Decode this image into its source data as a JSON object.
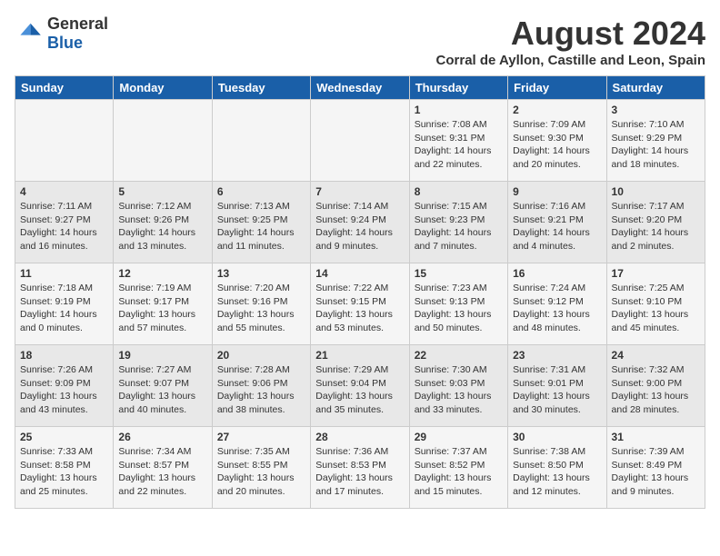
{
  "logo": {
    "general": "General",
    "blue": "Blue"
  },
  "title": {
    "month_year": "August 2024",
    "location": "Corral de Ayllon, Castille and Leon, Spain"
  },
  "days_of_week": [
    "Sunday",
    "Monday",
    "Tuesday",
    "Wednesday",
    "Thursday",
    "Friday",
    "Saturday"
  ],
  "weeks": [
    [
      {
        "day": "",
        "content": ""
      },
      {
        "day": "",
        "content": ""
      },
      {
        "day": "",
        "content": ""
      },
      {
        "day": "",
        "content": ""
      },
      {
        "day": "1",
        "content": "Sunrise: 7:08 AM\nSunset: 9:31 PM\nDaylight: 14 hours and 22 minutes."
      },
      {
        "day": "2",
        "content": "Sunrise: 7:09 AM\nSunset: 9:30 PM\nDaylight: 14 hours and 20 minutes."
      },
      {
        "day": "3",
        "content": "Sunrise: 7:10 AM\nSunset: 9:29 PM\nDaylight: 14 hours and 18 minutes."
      }
    ],
    [
      {
        "day": "4",
        "content": "Sunrise: 7:11 AM\nSunset: 9:27 PM\nDaylight: 14 hours and 16 minutes."
      },
      {
        "day": "5",
        "content": "Sunrise: 7:12 AM\nSunset: 9:26 PM\nDaylight: 14 hours and 13 minutes."
      },
      {
        "day": "6",
        "content": "Sunrise: 7:13 AM\nSunset: 9:25 PM\nDaylight: 14 hours and 11 minutes."
      },
      {
        "day": "7",
        "content": "Sunrise: 7:14 AM\nSunset: 9:24 PM\nDaylight: 14 hours and 9 minutes."
      },
      {
        "day": "8",
        "content": "Sunrise: 7:15 AM\nSunset: 9:23 PM\nDaylight: 14 hours and 7 minutes."
      },
      {
        "day": "9",
        "content": "Sunrise: 7:16 AM\nSunset: 9:21 PM\nDaylight: 14 hours and 4 minutes."
      },
      {
        "day": "10",
        "content": "Sunrise: 7:17 AM\nSunset: 9:20 PM\nDaylight: 14 hours and 2 minutes."
      }
    ],
    [
      {
        "day": "11",
        "content": "Sunrise: 7:18 AM\nSunset: 9:19 PM\nDaylight: 14 hours and 0 minutes."
      },
      {
        "day": "12",
        "content": "Sunrise: 7:19 AM\nSunset: 9:17 PM\nDaylight: 13 hours and 57 minutes."
      },
      {
        "day": "13",
        "content": "Sunrise: 7:20 AM\nSunset: 9:16 PM\nDaylight: 13 hours and 55 minutes."
      },
      {
        "day": "14",
        "content": "Sunrise: 7:22 AM\nSunset: 9:15 PM\nDaylight: 13 hours and 53 minutes."
      },
      {
        "day": "15",
        "content": "Sunrise: 7:23 AM\nSunset: 9:13 PM\nDaylight: 13 hours and 50 minutes."
      },
      {
        "day": "16",
        "content": "Sunrise: 7:24 AM\nSunset: 9:12 PM\nDaylight: 13 hours and 48 minutes."
      },
      {
        "day": "17",
        "content": "Sunrise: 7:25 AM\nSunset: 9:10 PM\nDaylight: 13 hours and 45 minutes."
      }
    ],
    [
      {
        "day": "18",
        "content": "Sunrise: 7:26 AM\nSunset: 9:09 PM\nDaylight: 13 hours and 43 minutes."
      },
      {
        "day": "19",
        "content": "Sunrise: 7:27 AM\nSunset: 9:07 PM\nDaylight: 13 hours and 40 minutes."
      },
      {
        "day": "20",
        "content": "Sunrise: 7:28 AM\nSunset: 9:06 PM\nDaylight: 13 hours and 38 minutes."
      },
      {
        "day": "21",
        "content": "Sunrise: 7:29 AM\nSunset: 9:04 PM\nDaylight: 13 hours and 35 minutes."
      },
      {
        "day": "22",
        "content": "Sunrise: 7:30 AM\nSunset: 9:03 PM\nDaylight: 13 hours and 33 minutes."
      },
      {
        "day": "23",
        "content": "Sunrise: 7:31 AM\nSunset: 9:01 PM\nDaylight: 13 hours and 30 minutes."
      },
      {
        "day": "24",
        "content": "Sunrise: 7:32 AM\nSunset: 9:00 PM\nDaylight: 13 hours and 28 minutes."
      }
    ],
    [
      {
        "day": "25",
        "content": "Sunrise: 7:33 AM\nSunset: 8:58 PM\nDaylight: 13 hours and 25 minutes."
      },
      {
        "day": "26",
        "content": "Sunrise: 7:34 AM\nSunset: 8:57 PM\nDaylight: 13 hours and 22 minutes."
      },
      {
        "day": "27",
        "content": "Sunrise: 7:35 AM\nSunset: 8:55 PM\nDaylight: 13 hours and 20 minutes."
      },
      {
        "day": "28",
        "content": "Sunrise: 7:36 AM\nSunset: 8:53 PM\nDaylight: 13 hours and 17 minutes."
      },
      {
        "day": "29",
        "content": "Sunrise: 7:37 AM\nSunset: 8:52 PM\nDaylight: 13 hours and 15 minutes."
      },
      {
        "day": "30",
        "content": "Sunrise: 7:38 AM\nSunset: 8:50 PM\nDaylight: 13 hours and 12 minutes."
      },
      {
        "day": "31",
        "content": "Sunrise: 7:39 AM\nSunset: 8:49 PM\nDaylight: 13 hours and 9 minutes."
      }
    ]
  ]
}
